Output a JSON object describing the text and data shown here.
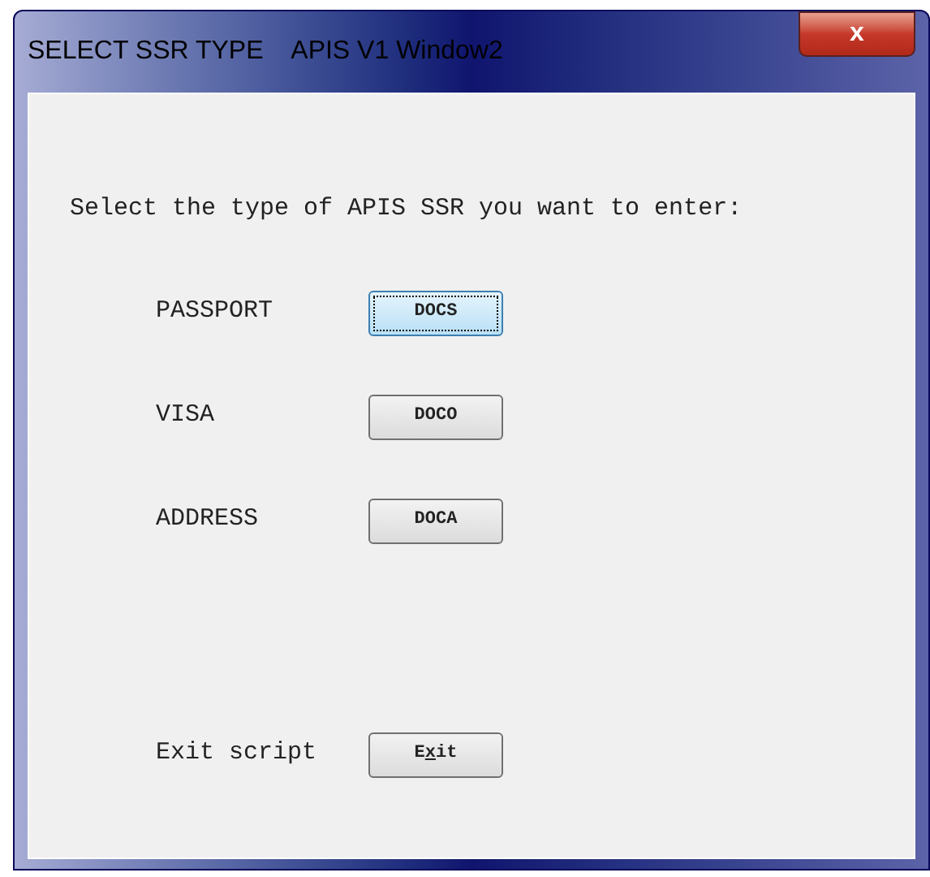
{
  "window": {
    "title": "SELECT SSR TYPE    APIS V1 Window2",
    "close": "x"
  },
  "prompt": "Select the type of APIS SSR you want to enter:",
  "options": [
    {
      "label": "PASSPORT",
      "button": "DOCS",
      "selected": true
    },
    {
      "label": "VISA",
      "button": "DOCO",
      "selected": false
    },
    {
      "label": "ADDRESS",
      "button": "DOCA",
      "selected": false
    }
  ],
  "exit": {
    "label": "Exit script",
    "button": {
      "before": "E",
      "key": "x",
      "after": "it"
    }
  }
}
